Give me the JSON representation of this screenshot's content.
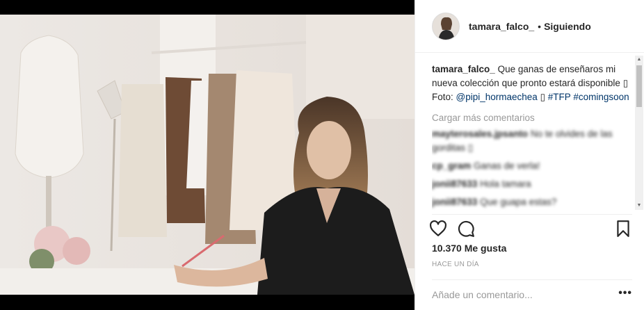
{
  "post": {
    "username": "tamara_falco_",
    "follow_separator": "•",
    "follow_status": "Siguiendo",
    "caption_user": "tamara_falco_",
    "caption_text": "Que ganas de enseñaros mi nueva colección que pronto estará disponible",
    "caption_glyph_1": "▯",
    "caption_photo_prefix": "Foto:",
    "caption_mention": "@pipi_hormaechea",
    "caption_glyph_2": "▯",
    "caption_hashtag_1": "#TFP",
    "caption_hashtag_2": "#comingsoon",
    "load_more": "Cargar más comentarios",
    "comments": [
      {
        "user": "mayterosales.jpsanto",
        "text": "No te olvides de las gorditas ▯"
      },
      {
        "user": "cp_gram",
        "text": "Ganas de verla!"
      },
      {
        "user": "jonii87633",
        "text": "Hola tamara"
      },
      {
        "user": "jonii87633",
        "text": "Que guapa estas?"
      }
    ],
    "likes": "10.370 Me gusta",
    "timestamp": "HACE UN DÍA",
    "comment_placeholder": "Añade un comentario...",
    "more_label": "•••"
  },
  "icons": {
    "like": "heart-icon",
    "comment": "comment-bubble-icon",
    "save": "bookmark-icon",
    "scroll_up": "▲",
    "scroll_down": "▼"
  },
  "colors": {
    "link": "#003569",
    "muted": "#999999",
    "text": "#262626",
    "border": "#efefef"
  }
}
